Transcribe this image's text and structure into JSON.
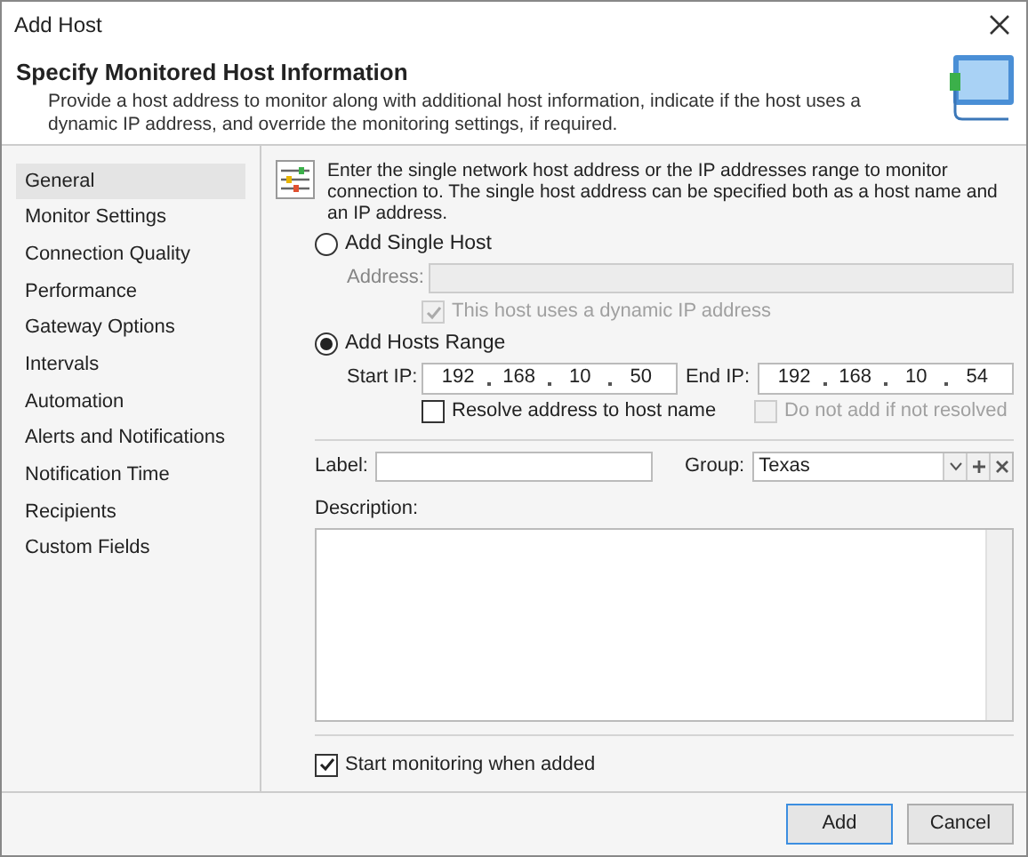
{
  "window": {
    "title": "Add Host"
  },
  "header": {
    "title": "Specify Monitored Host Information",
    "description": "Provide a host address to monitor along with additional host information, indicate if the host uses a dynamic IP address, and override the monitoring settings, if required."
  },
  "sidebar": {
    "items": [
      {
        "label": "General",
        "selected": true
      },
      {
        "label": "Monitor Settings",
        "selected": false
      },
      {
        "label": "Connection Quality",
        "selected": false
      },
      {
        "label": "Performance",
        "selected": false
      },
      {
        "label": "Gateway Options",
        "selected": false
      },
      {
        "label": "Intervals",
        "selected": false
      },
      {
        "label": "Automation",
        "selected": false
      },
      {
        "label": "Alerts and Notifications",
        "selected": false
      },
      {
        "label": "Notification Time",
        "selected": false
      },
      {
        "label": "Recipients",
        "selected": false
      },
      {
        "label": "Custom Fields",
        "selected": false
      }
    ]
  },
  "intro": "Enter the single network host address or the IP addresses range to monitor connection to. The single host address can be specified both as a host name and an IP address.",
  "single_host": {
    "label": "Add Single Host",
    "selected": false,
    "address_label": "Address:",
    "disabled": true,
    "dynamic_ip": {
      "label": "This host uses a dynamic IP address",
      "checked": true,
      "disabled": true
    }
  },
  "hosts_range": {
    "label": "Add Hosts Range",
    "selected": true,
    "start_ip": {
      "label": "Start IP:",
      "octets": [
        "192",
        "168",
        "10",
        "50"
      ]
    },
    "end_ip": {
      "label": "End IP:",
      "octets": [
        "192",
        "168",
        "10",
        "54"
      ]
    },
    "resolve": {
      "label": "Resolve address to host name",
      "checked": false,
      "disabled": false
    },
    "skip_unresolved": {
      "label": "Do not add if not resolved",
      "checked": false,
      "disabled": true
    }
  },
  "label_field": {
    "label": "Label:"
  },
  "group": {
    "label": "Group:",
    "value": "Texas"
  },
  "description": {
    "label": "Description:"
  },
  "start_monitoring": {
    "label": "Start monitoring when added",
    "checked": true
  },
  "buttons": [
    {
      "label": "Add",
      "default": true
    },
    {
      "label": "Cancel",
      "default": false
    }
  ]
}
